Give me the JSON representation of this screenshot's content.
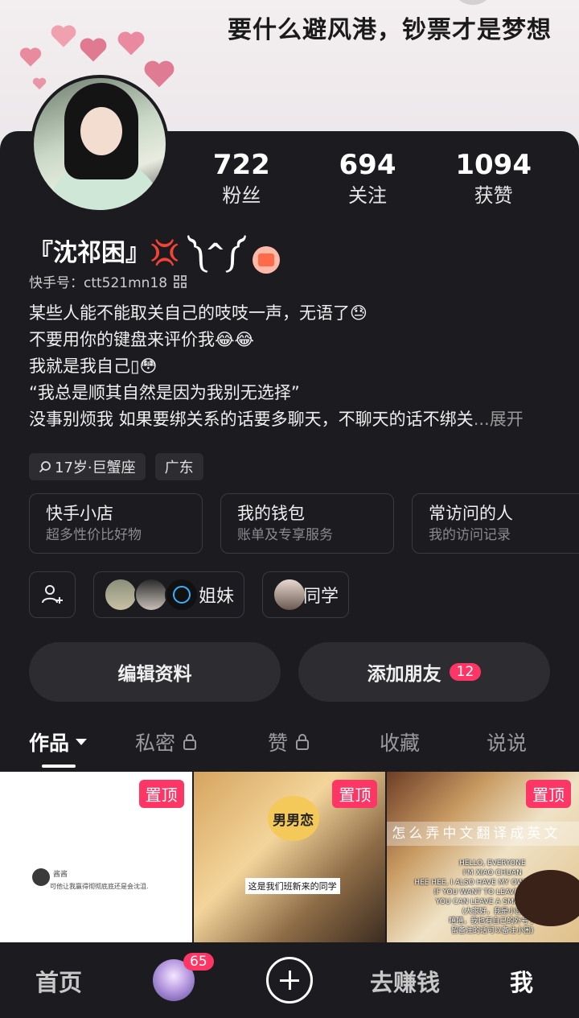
{
  "cover": {
    "text": "要什么避风港，钞票才是梦想"
  },
  "profile": {
    "name": "『沈祁困』💢 ༽^༼",
    "uid_label": "快手号：ctt521mn18",
    "stats": [
      {
        "value": "722",
        "label": "粉丝"
      },
      {
        "value": "694",
        "label": "关注"
      },
      {
        "value": "1094",
        "label": "获赞"
      }
    ],
    "bio": [
      "某些人能不能取关自己的吱吱一声，无语了😓",
      "不要用你的键盘来评价我😂😂",
      "我就是我自己▯😳",
      "“我总是顺其自然是因为我别无选择”",
      "没事别烦我 如果要绑关系的话要多聊天，不聊天的话不绑关"
    ],
    "bio_more": "...展开",
    "tags": [
      "17岁·巨蟹座",
      "广东"
    ]
  },
  "cards": [
    {
      "title": "快手小店",
      "sub": "超多性价比好物"
    },
    {
      "title": "我的钱包",
      "sub": "账单及专享服务"
    },
    {
      "title": "常访问的人",
      "sub": "我的访问记录"
    }
  ],
  "friends": {
    "group1_label": "姐妹",
    "group2_label": "同学"
  },
  "buttons": {
    "edit": "编辑资料",
    "add_friend": "添加朋友",
    "add_friend_badge": "12"
  },
  "tabs": [
    "作品",
    "私密",
    "赞",
    "收藏",
    "说说"
  ],
  "tiles": {
    "pin_label": "置顶",
    "t1_name": "酱酱",
    "t1_text": "可他让我赢得彻彻底底还是会沈沮.",
    "t2_title": "男男恋",
    "t2_sub": "这是我们班新来的同学",
    "t3_band": "怎么弄中文翻译成英文",
    "t3_note": "HELLO, EVERYONE\nI'M XIAO CHUAN\nHEE HEE, I ALSO HAVE MY OWN NICKNAME\nIF YOU WANT TO LEAVE A NOTE,\nYOU CAN LEAVE A SMALL NOTE\n(大家好，我是小困\n嘻嘻，我也有自己的外号了\n留备注的话可以备注小困)"
  },
  "bottom_nav": {
    "home": "首页",
    "avatar_badge": "65",
    "earn": "去赚钱",
    "me": "我"
  },
  "colors": {
    "accent": "#fe3666",
    "background": "#1b1b20"
  }
}
